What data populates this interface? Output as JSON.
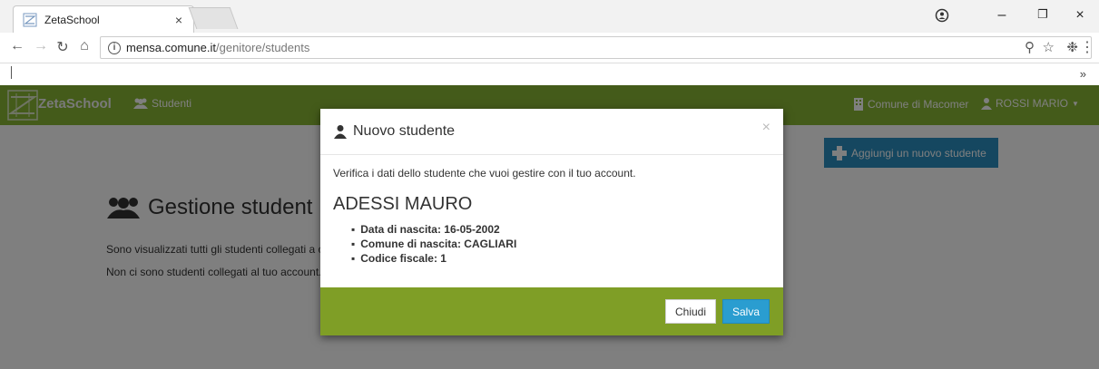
{
  "browser": {
    "tab_title": "ZetaSchool",
    "tab_close": "×",
    "url_host": "mensa.comune.it",
    "url_path": "/genitore/students",
    "bookmarks_more": "»",
    "window_controls": {
      "minimize": "–",
      "restore": "❐",
      "close": "×"
    }
  },
  "navbar": {
    "brand": "ZetaSchool",
    "studenti": "Studenti",
    "comune": "Comune di Macomer",
    "user": "ROSSI MARIO"
  },
  "page": {
    "title": "Gestione student",
    "text1": "Sono visualizzati tutti gli studenti collegati a c",
    "text2": "Non ci sono studenti collegati al tuo account.",
    "add_button": "Aggiungi un nuovo studente"
  },
  "modal": {
    "title": "Nuovo studente",
    "close": "×",
    "verify_text": "Verifica i dati dello studente che vuoi gestire con il tuo account.",
    "student_name": "ADESSI MAURO",
    "details": [
      "Data di nascita: 16-05-2002",
      "Comune di nascita: CAGLIARI",
      "Codice fiscale: 1"
    ],
    "btn_close": "Chiudi",
    "btn_save": "Salva"
  },
  "colors": {
    "navbar": "#89b734",
    "footer": "#7f9e26",
    "primary_button": "#2a9dd0"
  }
}
